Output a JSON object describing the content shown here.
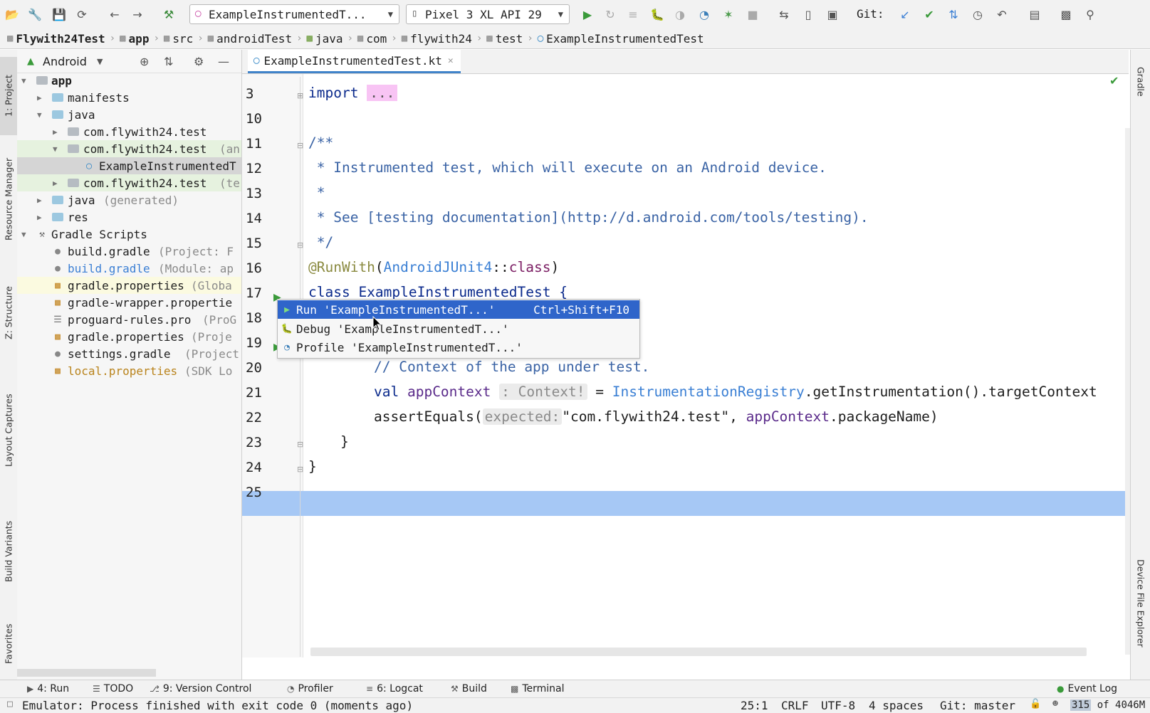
{
  "toolbar": {
    "run_config": "ExampleInstrumentedT...",
    "device": "Pixel 3 XL API 29",
    "git_label": "Git:"
  },
  "breadcrumb": [
    "Flywith24Test",
    "app",
    "src",
    "androidTest",
    "java",
    "com",
    "flywith24",
    "test",
    "ExampleInstrumentedTest"
  ],
  "left_stripe": {
    "project": "1: Project",
    "resource_manager": "Resource Manager",
    "structure": "Z: Structure",
    "layout_captures": "Layout Captures",
    "build_variants": "Build Variants",
    "favorites": "Favorites"
  },
  "right_stripe": {
    "gradle": "Gradle",
    "device_file_explorer": "Device File Explorer"
  },
  "project": {
    "view_mode": "Android",
    "tree": [
      {
        "label": "app",
        "extra": ""
      },
      {
        "label": "manifests",
        "extra": ""
      },
      {
        "label": "java",
        "extra": ""
      },
      {
        "label": "com.flywith24.test",
        "extra": ""
      },
      {
        "label": "com.flywith24.test",
        "extra": "(an"
      },
      {
        "label": "ExampleInstrumentedT",
        "extra": ""
      },
      {
        "label": "com.flywith24.test",
        "extra": "(te"
      },
      {
        "label": "java",
        "extra": "(generated)"
      },
      {
        "label": "res",
        "extra": ""
      },
      {
        "label": "Gradle Scripts",
        "extra": ""
      },
      {
        "label": "build.gradle",
        "extra": "(Project: F"
      },
      {
        "label": "build.gradle",
        "extra": "(Module: ap"
      },
      {
        "label": "gradle.properties",
        "extra": "(Globa"
      },
      {
        "label": "gradle-wrapper.propertie",
        "extra": ""
      },
      {
        "label": "proguard-rules.pro",
        "extra": "(ProG"
      },
      {
        "label": "gradle.properties",
        "extra": "(Proje"
      },
      {
        "label": "settings.gradle",
        "extra": "(Project"
      },
      {
        "label": "local.properties",
        "extra": "(SDK Lo"
      }
    ]
  },
  "editor": {
    "tab": "ExampleInstrumentedTest.kt",
    "line_numbers": [
      "3",
      "10",
      "11",
      "12",
      "13",
      "14",
      "15",
      "16",
      "17",
      "18",
      "19",
      "20",
      "21",
      "22",
      "23",
      "24",
      "25"
    ],
    "code": {
      "l3_kw": "import",
      "l3_fold": "...",
      "l11": "/**",
      "l12": " * Instrumented test, which will execute on an Android device.",
      "l13": " *",
      "l14": " * See [testing documentation](http://d.android.com/tools/testing).",
      "l15": " */",
      "l16_ann": "@RunWith",
      "l16_open": "(",
      "l16_cls": "AndroidJUnit4",
      "l16_sep": "::",
      "l16_kw": "class",
      "l16_close": ")",
      "l17": "class ExampleInstrumentedTest {",
      "l20": "// Context of the app under test.",
      "l21_kw": "val",
      "l21_var": " appContext",
      "l21_hint": ": Context!",
      "l21_eq": " = ",
      "l21_cls": "InstrumentationRegistry",
      "l21_rest": ".getInstrumentation().targetContext",
      "l22_fn": "assertEquals(",
      "l22_hint": "expected:",
      "l22_str": "\"com.flywith24.test\"",
      "l22_comma": ", ",
      "l22_var": "appContext",
      "l22_rest": ".packageName)",
      "l23": "}",
      "l24": "}"
    }
  },
  "popup": {
    "run": "Run 'ExampleInstrumentedT...'",
    "run_shortcut": "Ctrl+Shift+F10",
    "debug": "Debug 'ExampleInstrumentedT...'",
    "profile": "Profile 'ExampleInstrumentedT...'"
  },
  "bottom_tools": {
    "run": "4: Run",
    "todo": "TODO",
    "vcs": "9: Version Control",
    "profiler": "Profiler",
    "logcat": "6: Logcat",
    "build": "Build",
    "terminal": "Terminal",
    "event_log": "Event Log"
  },
  "status": {
    "message": "Emulator: Process finished with exit code 0 (moments ago)",
    "position": "25:1",
    "line_sep": "CRLF",
    "encoding": "UTF-8",
    "indent": "4 spaces",
    "git": "Git: master",
    "memory_used": "315",
    "memory_sep": " of ",
    "memory_total": "4046M"
  },
  "colors": {
    "accent": "#2f65ca",
    "current_line": "#a6c8f5",
    "comment": "#3a63a5",
    "keyword": "#0b2a8c"
  }
}
